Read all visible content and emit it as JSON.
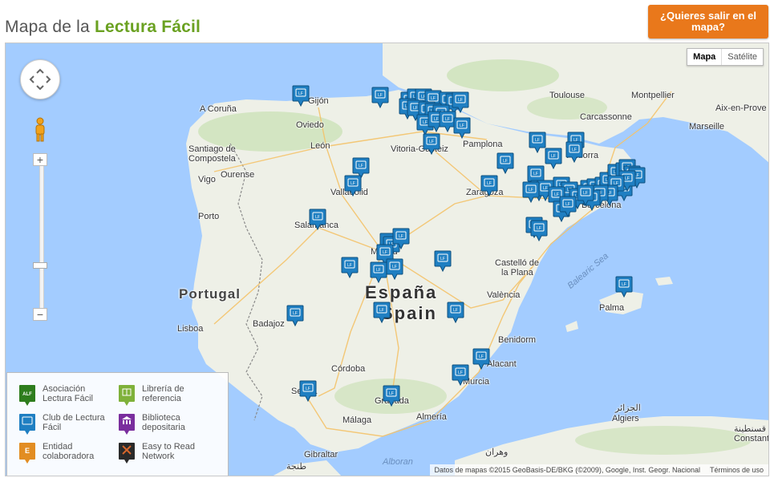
{
  "header": {
    "title_prefix": "Mapa de la ",
    "title_accent": "Lectura Fácil",
    "cta_label": "¿Quieres salir en el mapa?"
  },
  "map_controls": {
    "maptype_map": "Mapa",
    "maptype_satellite": "Satélite",
    "zoom_in": "+",
    "zoom_out": "−"
  },
  "places": {
    "gijon": "Gijón",
    "a_coruna": "A Coruña",
    "oviedo": "Oviedo",
    "santiago1": "Santiago de",
    "santiago2": "Compostela",
    "leon": "León",
    "ourense": "Ourense",
    "vigo": "Vigo",
    "vitoria": "Vitoria-Gasteiz",
    "pamplona": "Pamplona",
    "toulouse": "Toulouse",
    "montpellier": "Montpellier",
    "carcassonne": "Carcassonne",
    "aix": "Aix-en-Prove",
    "marseille": "Marseille",
    "andorra": "Andorra",
    "valladolid": "Valladolid",
    "zaragoza": "Zaragoza",
    "barcelona": "Barcelona",
    "porto": "Porto",
    "salamanca": "Salamanca",
    "madrid": "Madrid",
    "portugal": "Portugal",
    "espana": "España",
    "spain": "Spain",
    "castellon1": "Castelló de",
    "castellon2": "la Plana",
    "valencia": "València",
    "balearic": "Balearic Sea",
    "palma": "Palma",
    "lisboa": "Lisboa",
    "badajoz": "Badajoz",
    "benidorm": "Benidorm",
    "alacant": "Alacant",
    "cordoba": "Córdoba",
    "murcia": "Murcia",
    "sevilla": "Sevilla",
    "granada": "Granada",
    "almeria": "Almería",
    "malaga": "Málaga",
    "gibraltar": "Gibraltar",
    "alboran": "Alboran",
    "algiers": "Algiers",
    "algiers_ar": "الجزائر",
    "constant": "Constant",
    "qusantina": "قسنطينة",
    "wahran": "وهران",
    "tanja": "طنجة"
  },
  "legend": [
    {
      "label": "Asociación Lectura Fácil",
      "color": "#2e7d1d",
      "glyph": "ALF",
      "icon": "alf-marker-icon"
    },
    {
      "label": "Librería de referencia",
      "color": "#7fb13a",
      "glyph": "book",
      "icon": "book-marker-icon"
    },
    {
      "label": "Club de Lectura Fácil",
      "color": "#1f7fc2",
      "glyph": "LF",
      "icon": "lf-marker-icon"
    },
    {
      "label": "Biblioteca depositaria",
      "color": "#7a2e9e",
      "glyph": "bank",
      "icon": "library-marker-icon"
    },
    {
      "label": "Entidad colaboradora",
      "color": "#e28d22",
      "glyph": "E",
      "icon": "entity-marker-icon"
    },
    {
      "label": "Easy to Read Network",
      "color": "#2a2a2a",
      "glyph": "X",
      "icon": "network-marker-icon"
    }
  ],
  "attribution": {
    "data": "Datos de mapas ©2015 GeoBasis-DE/BKG (©2009), Google, Inst. Geogr. Nacional",
    "terms": "Términos de uso"
  },
  "marker_glyph": "LF"
}
